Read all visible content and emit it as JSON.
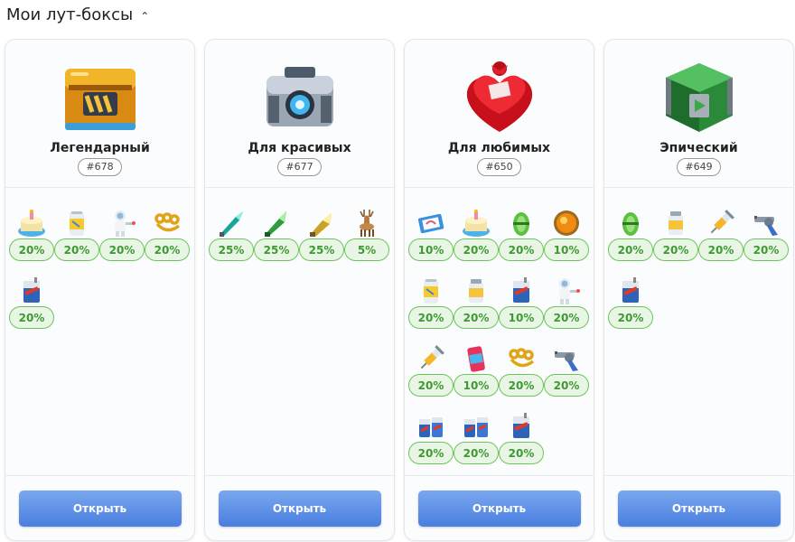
{
  "header": {
    "title": "Мои лут-боксы",
    "chevron": "chevron-up-icon"
  },
  "boxes": [
    {
      "name": "Легендарный",
      "id": "#678",
      "icon": "gold-chest-icon",
      "open_label": "Открыть",
      "items": [
        {
          "icon": "cake-icon",
          "chance": "20%"
        },
        {
          "icon": "can-icon",
          "chance": "20%"
        },
        {
          "icon": "astronaut-icon",
          "chance": "20%"
        },
        {
          "icon": "brass-knuckles-icon",
          "chance": "20%"
        },
        {
          "icon": "juice-box-icon",
          "chance": "20%"
        }
      ]
    },
    {
      "name": "Для красивых",
      "id": "#677",
      "icon": "tech-chest-icon",
      "open_label": "Открыть",
      "items": [
        {
          "icon": "teal-crystal-icon",
          "chance": "25%"
        },
        {
          "icon": "green-crystal-icon",
          "chance": "25%"
        },
        {
          "icon": "gold-crystal-icon",
          "chance": "25%"
        },
        {
          "icon": "deer-icon",
          "chance": "5%"
        }
      ]
    },
    {
      "name": "Для любимых",
      "id": "#650",
      "icon": "heart-box-icon",
      "open_label": "Открыть",
      "items": [
        {
          "icon": "card-icon",
          "chance": "10%"
        },
        {
          "icon": "cake-icon",
          "chance": "20%"
        },
        {
          "icon": "green-egg-icon",
          "chance": "20%"
        },
        {
          "icon": "orange-orb-icon",
          "chance": "10%"
        },
        {
          "icon": "can-icon",
          "chance": "20%"
        },
        {
          "icon": "jar-icon",
          "chance": "20%"
        },
        {
          "icon": "juice-box-icon",
          "chance": "10%"
        },
        {
          "icon": "astronaut-icon",
          "chance": "20%"
        },
        {
          "icon": "syringe-icon",
          "chance": "20%"
        },
        {
          "icon": "soda-can-icon",
          "chance": "10%"
        },
        {
          "icon": "brass-knuckles-icon",
          "chance": "20%"
        },
        {
          "icon": "revolver-icon",
          "chance": "20%"
        },
        {
          "icon": "juice-pack-icon",
          "chance": "20%"
        },
        {
          "icon": "juice-pack-icon",
          "chance": "20%"
        },
        {
          "icon": "juice-box-icon",
          "chance": "20%"
        }
      ]
    },
    {
      "name": "Эпический",
      "id": "#649",
      "icon": "green-chest-icon",
      "open_label": "Открыть",
      "items": [
        {
          "icon": "green-egg-icon",
          "chance": "20%"
        },
        {
          "icon": "jar-icon",
          "chance": "20%"
        },
        {
          "icon": "syringe-icon",
          "chance": "20%"
        },
        {
          "icon": "revolver-icon",
          "chance": "20%"
        },
        {
          "icon": "juice-box-icon",
          "chance": "20%"
        }
      ]
    }
  ]
}
